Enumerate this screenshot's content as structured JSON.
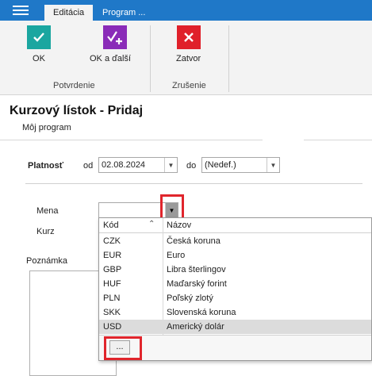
{
  "ribbon": {
    "tabs": [
      "Editácia",
      "Program ..."
    ],
    "buttons": {
      "ok": "OK",
      "ok_next": "OK a ďalší",
      "close": "Zatvor"
    },
    "groups": {
      "confirm": "Potvrdenie",
      "cancel": "Zrušenie"
    },
    "colors": {
      "ok": "#1aa6a0",
      "ok_next": "#8a2bb8",
      "close": "#e0202a",
      "bar": "#1f78c8"
    }
  },
  "page": {
    "title": "Kurzový lístok - Pridaj",
    "subtitle": "Môj program"
  },
  "form": {
    "validity_label": "Platnosť",
    "from_label": "od",
    "from_value": "02.08.2024",
    "to_label": "do",
    "to_value": "(Nedef.)",
    "currency_label": "Mena",
    "currency_value": "",
    "rate_label": "Kurz",
    "note_label": "Poznámka"
  },
  "dropdown": {
    "columns": [
      "Kód",
      "Názov"
    ],
    "rows": [
      {
        "code": "CZK",
        "name": "Česká koruna"
      },
      {
        "code": "EUR",
        "name": "Euro"
      },
      {
        "code": "GBP",
        "name": "Libra šterlingov"
      },
      {
        "code": "HUF",
        "name": "Maďarský forint"
      },
      {
        "code": "PLN",
        "name": "Poľský zlotý"
      },
      {
        "code": "SKK",
        "name": "Slovenská koruna"
      },
      {
        "code": "USD",
        "name": "Americký dolár"
      }
    ],
    "selected": "USD",
    "more_label": "..."
  }
}
